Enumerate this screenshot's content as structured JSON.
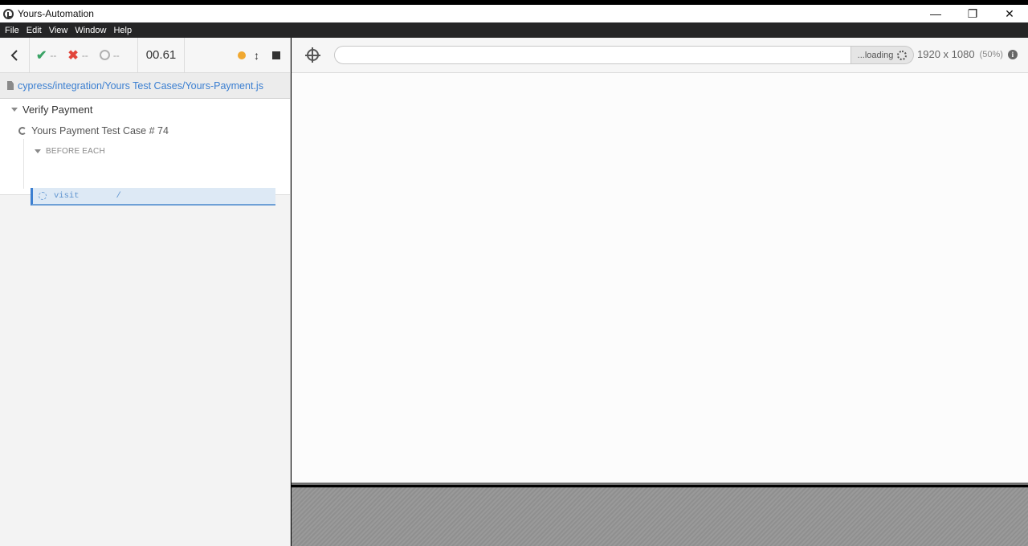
{
  "window": {
    "title": "Yours-Automation",
    "controls": {
      "minimize": "—",
      "maximize": "❐",
      "close": "✕"
    }
  },
  "menu": [
    "File",
    "Edit",
    "View",
    "Window",
    "Help"
  ],
  "reporter": {
    "stats": {
      "passed": "--",
      "failed": "--",
      "pending": "--"
    },
    "duration": "00.61",
    "spec_path": "cypress/integration/Yours Test Cases/Yours-Payment.js",
    "suite": "Verify Payment",
    "test": "Yours Payment Test Case # 74",
    "hook": "BEFORE EACH",
    "command": {
      "name": "visit",
      "message": "/"
    }
  },
  "aut": {
    "url": "",
    "loading": "...loading",
    "viewport_size": "1920 x 1080",
    "viewport_scale": "(50%)"
  },
  "colors": {
    "pass": "#3aa365",
    "fail": "#e2453b",
    "link": "#3b7fd1",
    "running": "#f0a830"
  },
  "icons": [
    "app-logo-icon",
    "back-chevron-icon",
    "check-icon",
    "cross-icon",
    "pending-ring-icon",
    "running-dot-icon",
    "updown-arrow-icon",
    "stop-icon",
    "file-icon",
    "caret-down-icon",
    "spinner-icon",
    "selector-crosshair-icon",
    "loading-spinner-icon",
    "info-icon"
  ]
}
